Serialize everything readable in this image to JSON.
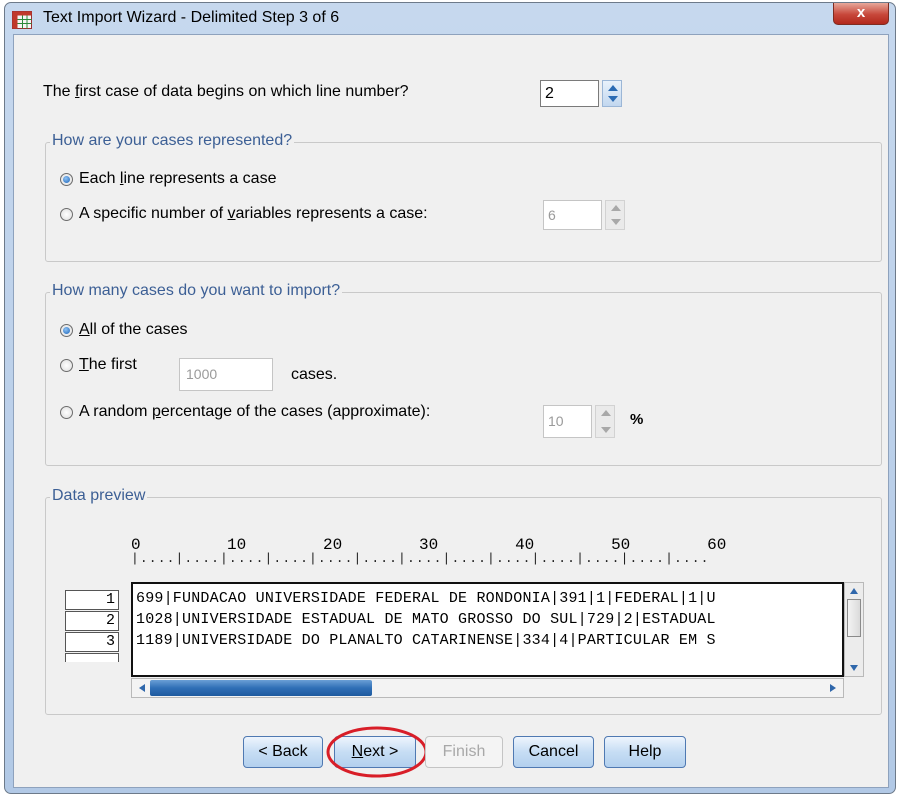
{
  "window": {
    "title": "Text Import Wizard - Delimited Step 3 of 6",
    "close_label": "x"
  },
  "first_line": {
    "label_pre": "The ",
    "label_u": "f",
    "label_post": "irst case of data begins on which line number?",
    "value": "2"
  },
  "cases_group": {
    "legend": "How are your cases represented?",
    "option1_pre": "Each ",
    "option1_u": "l",
    "option1_post": "ine represents a case",
    "option2_pre": "A specific number of ",
    "option2_u": "v",
    "option2_post": "ariables represents a case:",
    "option2_value": "6",
    "selected": "option1"
  },
  "import_group": {
    "legend": "How many cases do you want to import?",
    "option1_u": "A",
    "option1_post": "ll of the cases",
    "option2_u": "T",
    "option2_post": "he first",
    "option2_value": "1000",
    "option2_suffix": "cases.",
    "option3_pre": "A random ",
    "option3_u": "p",
    "option3_post": "ercentage of the cases (approximate):",
    "option3_value": "10",
    "option3_suffix": "%",
    "selected": "option1"
  },
  "preview": {
    "legend": "Data preview",
    "ruler_numbers": "0         10        20        30        40        50        60",
    "ruler_dots": "|....|....|....|....|....|....|....|....|....|....|....|....|....",
    "rows": [
      {
        "num": "1",
        "text": "699|FUNDACAO UNIVERSIDADE FEDERAL DE RONDONIA|391|1|FEDERAL|1|U"
      },
      {
        "num": "2",
        "text": "1028|UNIVERSIDADE ESTADUAL DE MATO GROSSO DO SUL|729|2|ESTADUAL"
      },
      {
        "num": "3",
        "text": "1189|UNIVERSIDADE DO PLANALTO CATARINENSE|334|4|PARTICULAR EM S"
      }
    ]
  },
  "buttons": {
    "back": "< Back",
    "next_u": "N",
    "next_post": "ext >",
    "finish": "Finish",
    "cancel": "Cancel",
    "help": "Help"
  },
  "colors": {
    "legend_text": "#3c5f95",
    "highlight_circle": "#d81e28"
  }
}
